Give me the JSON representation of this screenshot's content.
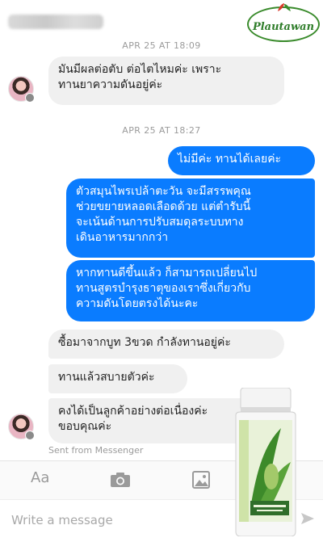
{
  "header": {
    "logo_text": "Plautawan"
  },
  "messages": {
    "ts_top": "APR 25 AT 18:09",
    "m1": [
      "มันมีผลต่อตับ ต่อไตไหมค่ะ เพราะ",
      "ทานยาความดันอยู่ค่ะ"
    ],
    "ts_mid": "APR 25 AT 18:27",
    "m2": "ไม่มีค่ะ ทานได้เลยค่ะ",
    "m3": [
      "ตัวสมุนไพรเปล้าตะวัน จะมีสรรพคุณ",
      "ช่วยขยายหลอดเลือดด้วย แต่ตำรับนี้",
      "จะเน้นด้านการปรับสมดุลระบบทาง",
      "เดินอาหารมากกว่า"
    ],
    "m4": [
      "หากทานดีขึ้นแล้ว ก็สามารถเปลี่ยนไป",
      "ทานสูตรบำรุงธาตุของเราซึ่งเกี่ยวกับ",
      "ความดันโดยตรงได้นะคะ"
    ],
    "m5": "ซื้อมาจากบูท  3ขวด กำลังทานอยู่ค่ะ",
    "m6": "ทานแล้วสบายตัวค่ะ",
    "m7": [
      "คงได้เป็นลูกค้าอย่างต่อเนื่องค่ะ",
      "ขอบคุณค่ะ"
    ],
    "sent_from": "Sent from Messenger"
  },
  "toolbar": {
    "aa_label": "Aa",
    "icons": [
      "camera-icon",
      "image-icon",
      "mic-icon"
    ]
  },
  "composer": {
    "placeholder": "Write a message"
  },
  "colors": {
    "outgoing": "#0a7cff",
    "incoming": "#f0f0f0",
    "brand_green": "#3a8b2c"
  }
}
